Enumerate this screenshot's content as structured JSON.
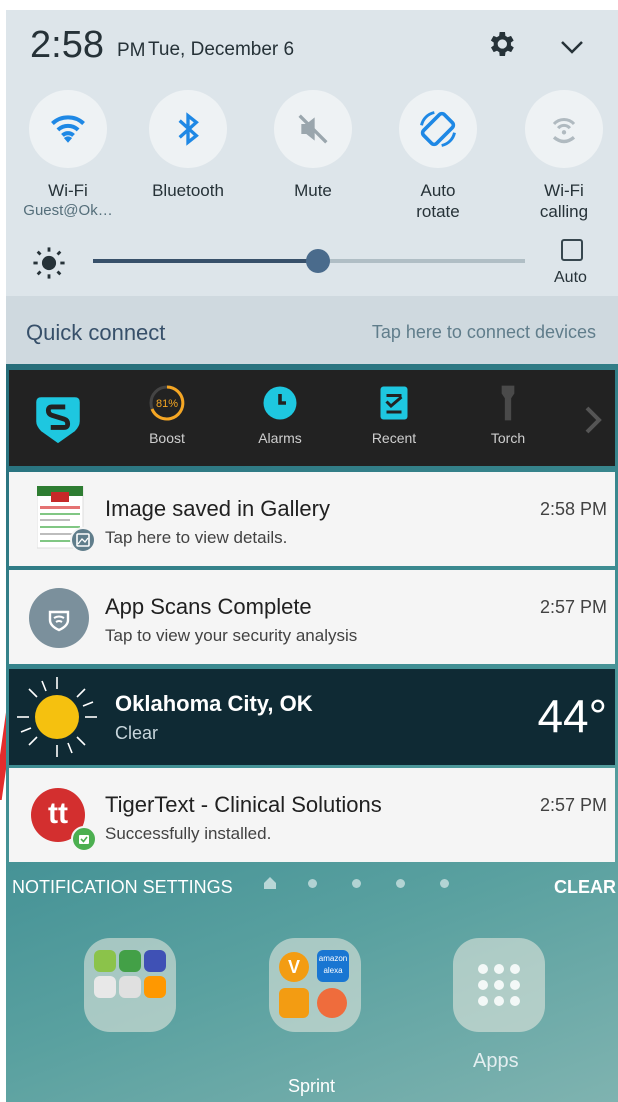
{
  "status": {
    "time": "2:58",
    "ampm": "PM",
    "date": "Tue, December 6"
  },
  "quick_settings": {
    "tiles": [
      {
        "label": "Wi-Fi",
        "sub": "Guest@Ok…",
        "icon": "wifi-icon",
        "active": true
      },
      {
        "label": "Bluetooth",
        "sub": "",
        "icon": "bluetooth-icon",
        "active": true
      },
      {
        "label": "Mute",
        "sub": "",
        "icon": "mute-icon",
        "active": false
      },
      {
        "label": "Auto rotate",
        "sub": "",
        "icon": "auto-rotate-icon",
        "active": true
      },
      {
        "label": "Wi-Fi calling",
        "sub": "",
        "icon": "wifi-calling-icon",
        "active": false
      }
    ],
    "brightness_level": 0.52,
    "auto_label": "Auto",
    "auto_checked": false
  },
  "quick_connect": {
    "title": "Quick connect",
    "hint": "Tap here to connect devices"
  },
  "toolbar": {
    "boost_percent": "81%",
    "items": [
      "Boost",
      "Alarms",
      "Recent",
      "Torch"
    ]
  },
  "notifications": [
    {
      "title": "Image saved in Gallery",
      "text": "Tap here to view details.",
      "time": "2:58 PM"
    },
    {
      "title": "App Scans Complete",
      "text": "Tap to view your security analysis",
      "time": "2:57 PM"
    }
  ],
  "weather": {
    "city": "Oklahoma City, OK",
    "condition": "Clear",
    "temp": "44°"
  },
  "tigertext": {
    "title": "TigerText - Clinical Solutions",
    "text": "Successfully installed.",
    "time": "2:57 PM",
    "logo_text": "tt"
  },
  "footer": {
    "settings": "NOTIFICATION SETTINGS",
    "clear": "CLEAR"
  },
  "home": {
    "apps_label": "Apps",
    "carrier": "Sprint",
    "amazon_text": "amazon",
    "alexa_text": "alexa"
  },
  "colors": {
    "accent": "#1e88e5",
    "toolbar_cyan": "#1ec7e0",
    "boost_orange": "#f5a623"
  }
}
